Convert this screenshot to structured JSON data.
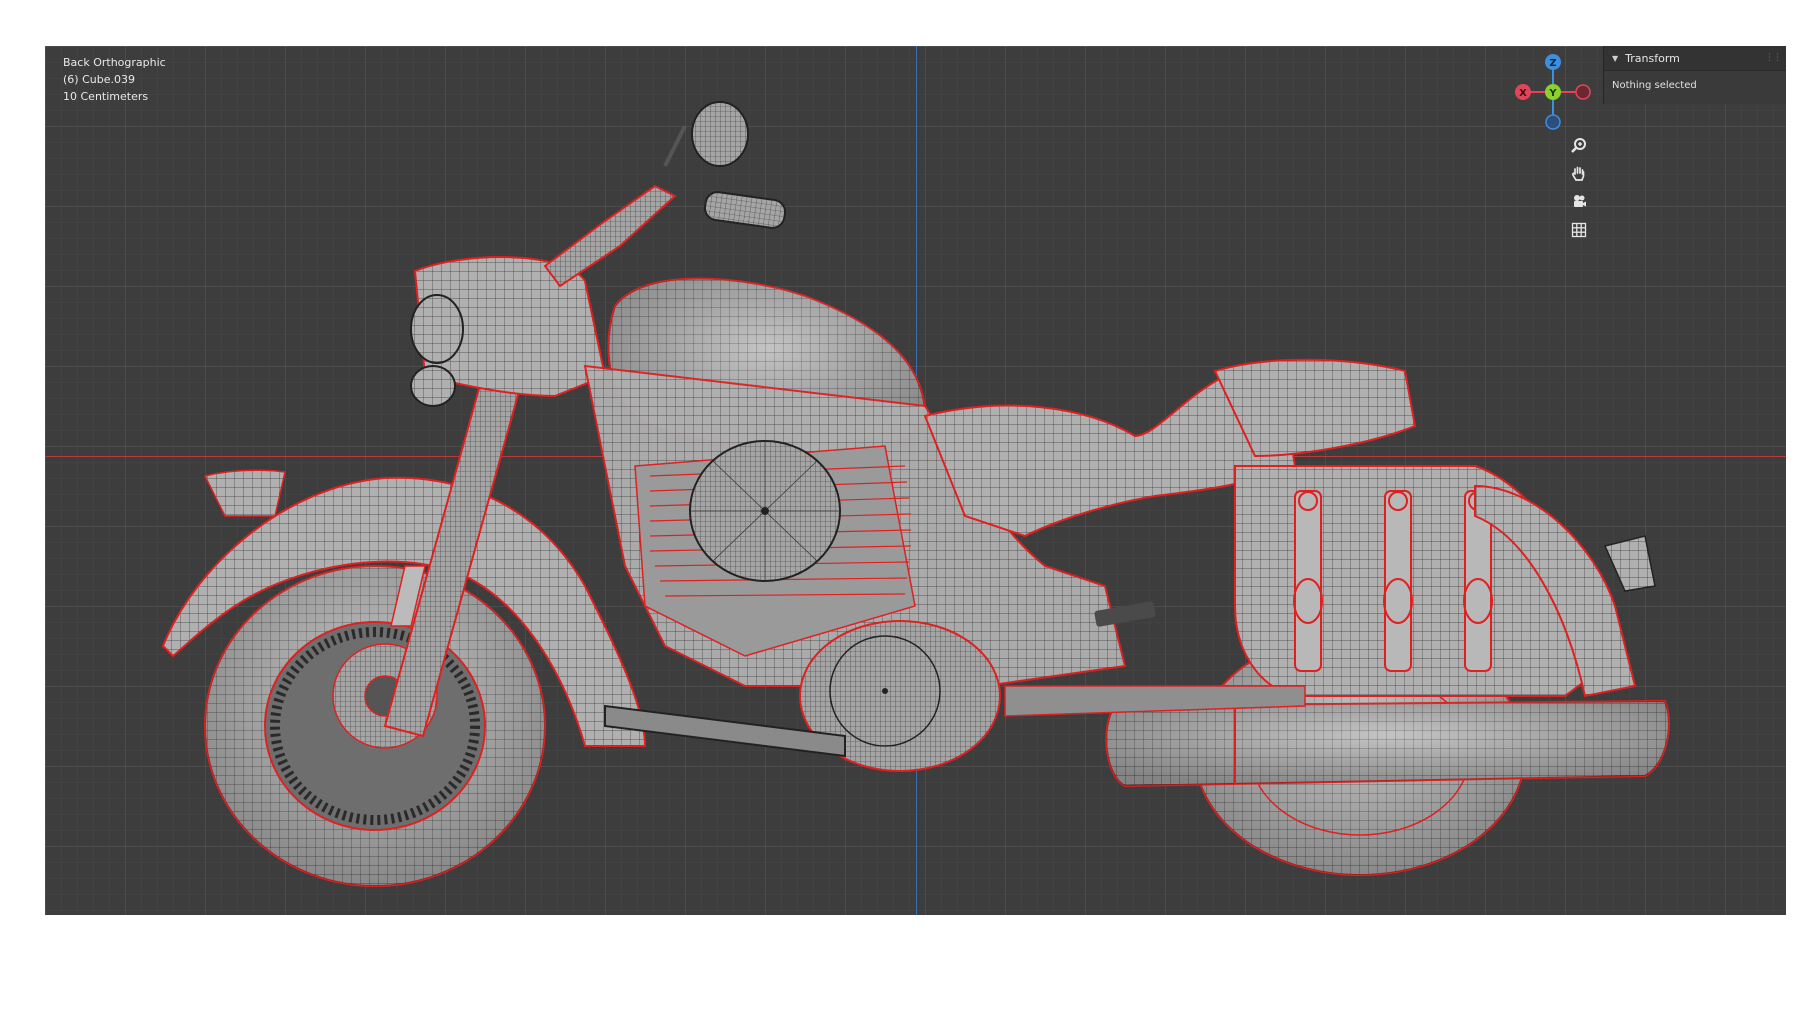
{
  "viewport": {
    "view_name": "Back Orthographic",
    "object_info": "(6) Cube.039",
    "grid_scale": "10 Centimeters"
  },
  "gizmo": {
    "z_label": "Z",
    "y_label": "Y",
    "x_label": "X",
    "colors": {
      "x": "#e2455a",
      "y": "#8bd12c",
      "z": "#3d8fe0"
    }
  },
  "nav_buttons": [
    {
      "name": "zoom",
      "icon": "zoom-icon"
    },
    {
      "name": "pan",
      "icon": "hand-icon"
    },
    {
      "name": "camera",
      "icon": "camera-icon"
    },
    {
      "name": "grid",
      "icon": "grid-icon"
    }
  ],
  "sidebar": {
    "panel_title": "Transform",
    "panel_content": "Nothing selected"
  },
  "colors": {
    "viewport_bg": "#3d3d3d",
    "mesh_fill": "#a9a9a9",
    "wire": "#2b2b2b",
    "seam": "#e02020"
  }
}
